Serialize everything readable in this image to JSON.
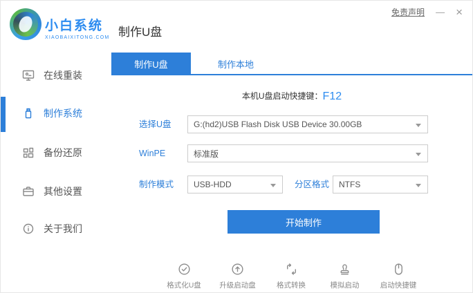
{
  "window": {
    "disclaimer": "免责声明",
    "minimize": "—",
    "close": "×"
  },
  "header": {
    "logo_title": "小白系统",
    "logo_subtitle": "XIAOBAIXITONG.COM",
    "page_title": "制作U盘"
  },
  "sidebar": {
    "items": [
      {
        "label": "在线重装",
        "icon": "monitor-reinstall-icon",
        "active": false
      },
      {
        "label": "制作系统",
        "icon": "usb-drive-icon",
        "active": true
      },
      {
        "label": "备份还原",
        "icon": "backup-restore-icon",
        "active": false
      },
      {
        "label": "其他设置",
        "icon": "settings-box-icon",
        "active": false
      },
      {
        "label": "关于我们",
        "icon": "info-icon",
        "active": false
      }
    ]
  },
  "tabs": [
    {
      "label": "制作U盘",
      "active": true
    },
    {
      "label": "制作本地",
      "active": false
    }
  ],
  "main": {
    "hotkey_label": "本机U盘启动快捷键：",
    "hotkey_value": "F12",
    "form": {
      "select_usb_label": "选择U盘",
      "select_usb_value": "G:(hd2)USB Flash Disk USB Device 30.00GB",
      "winpe_label": "WinPE",
      "winpe_value": "标准版",
      "mode_label": "制作模式",
      "mode_value": "USB-HDD",
      "partition_label": "分区格式",
      "partition_value": "NTFS"
    },
    "start_button": "开始制作"
  },
  "footer_tools": [
    {
      "label": "格式化U盘",
      "icon": "check-circle-icon"
    },
    {
      "label": "升级启动盘",
      "icon": "arrow-up-circle-icon"
    },
    {
      "label": "格式转换",
      "icon": "format-convert-icon"
    },
    {
      "label": "模拟启动",
      "icon": "stamp-icon"
    },
    {
      "label": "启动快捷键",
      "icon": "mouse-icon"
    }
  ],
  "colors": {
    "primary": "#2d7fd9",
    "logo_blue": "#2d8cf0",
    "muted_gray": "#8a8a8a"
  }
}
